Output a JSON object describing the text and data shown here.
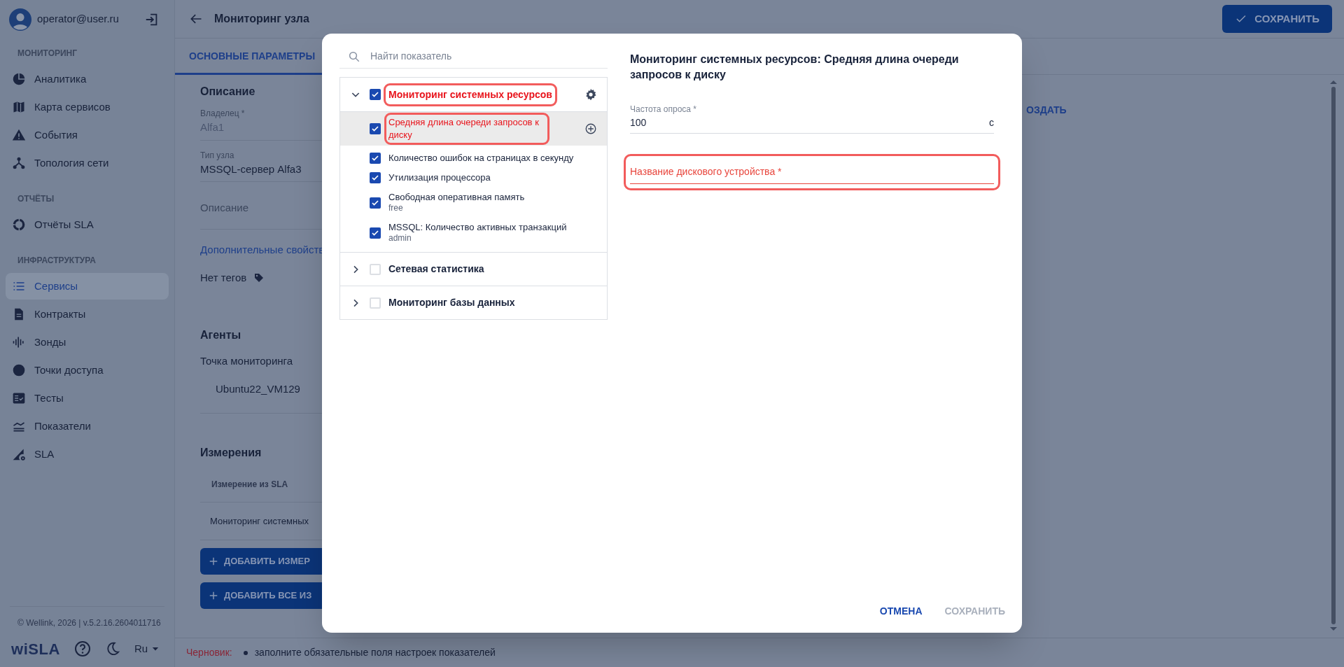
{
  "sidebar": {
    "user": "operator@user.ru",
    "sections": [
      {
        "title": "МОНИТОРИНГ",
        "items": [
          {
            "label": "Аналитика",
            "selected": false
          },
          {
            "label": "Карта сервисов",
            "selected": false
          },
          {
            "label": "События",
            "selected": false
          },
          {
            "label": "Топология сети",
            "selected": false
          }
        ]
      },
      {
        "title": "ОТЧЁТЫ",
        "items": [
          {
            "label": "Отчёты SLA",
            "selected": false
          }
        ]
      },
      {
        "title": "ИНФРАСТРУКТУРА",
        "items": [
          {
            "label": "Сервисы",
            "selected": true
          },
          {
            "label": "Контракты",
            "selected": false
          },
          {
            "label": "Зонды",
            "selected": false
          },
          {
            "label": "Точки доступа",
            "selected": false
          },
          {
            "label": "Тесты",
            "selected": false
          },
          {
            "label": "Показатели",
            "selected": false
          },
          {
            "label": "SLA",
            "selected": false
          }
        ]
      }
    ],
    "copyright": "© Wellink, 2026 | v.5.2.16.2604011716",
    "logo": "wiSLA",
    "language": "Ru"
  },
  "header": {
    "title": "Мониторинг узла",
    "save_button": "СОХРАНИТЬ"
  },
  "tabs": [
    {
      "label": "ОСНОВНЫЕ ПАРАМЕТРЫ",
      "selected": true
    }
  ],
  "form": {
    "description_title": "Описание",
    "fields": [
      {
        "label": "Владелец *",
        "value": "Alfa1",
        "disabled": true
      },
      {
        "label": "Тип узла",
        "value": "MSSQL-сервер Alfa3",
        "disabled": false
      }
    ],
    "description_placeholder": "Описание",
    "extra_link": "Дополнительные свойств",
    "tags": "Нет тегов",
    "agents_title": "Агенты",
    "monitoring_point_label": "Точка мониторинга",
    "monitoring_point": "Ubuntu22_VM129",
    "measurements_title": "Измерения",
    "table_column": "Измерение из SLA",
    "table_rows": [
      "Мониторинг системных"
    ],
    "buttons": [
      "ДОБАВИТЬ ИЗМЕР",
      "ДОБАВИТЬ ВСЕ ИЗ"
    ]
  },
  "create_link": "ОЗДАТЬ",
  "status_bar": {
    "label": "Черновик:",
    "messages": [
      "заполните обязательные поля настроек показателей"
    ]
  },
  "dialog": {
    "search": {
      "placeholder": "Найти показатель"
    },
    "groups": [
      {
        "title": "Мониторинг системных ресурсов",
        "expanded": true,
        "checked": true,
        "error": true,
        "items": [
          {
            "label": "Средняя длина очереди запросов к диску",
            "checked": true,
            "selected": true,
            "error": true
          },
          {
            "label": "Количество ошибок на страницах в секунду",
            "checked": true,
            "selected": false,
            "error": false
          },
          {
            "label": "Утилизация процессора",
            "checked": true,
            "selected": false,
            "error": false
          },
          {
            "label": "Свободная оперативная память",
            "sublabel": "free",
            "checked": true,
            "selected": false,
            "error": false
          },
          {
            "label": "MSSQL: Количество активных транзакций",
            "sublabel": "admin",
            "checked": true,
            "selected": false,
            "error": false
          }
        ]
      },
      {
        "title": "Сетевая статистика",
        "expanded": false,
        "checked": false,
        "error": false
      },
      {
        "title": "Мониторинг базы данных",
        "expanded": false,
        "checked": false,
        "error": false
      }
    ],
    "panel_title": "Мониторинг системных ресурсов: Средняя длина очереди запросов к диску",
    "fields": [
      {
        "label": "Частота опроса *",
        "value": "100",
        "unit": "с",
        "error": false
      },
      {
        "label": "Название дискового устройства *",
        "error": true
      }
    ],
    "buttons": [
      {
        "label": "ОТМЕНА",
        "disabled": false
      },
      {
        "label": "СОХРАНИТЬ",
        "disabled": true
      }
    ]
  }
}
